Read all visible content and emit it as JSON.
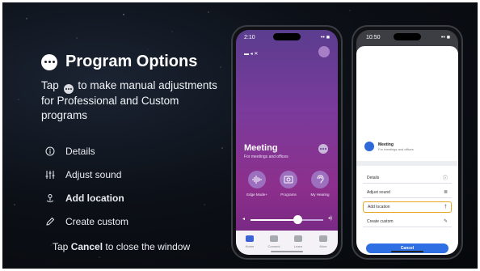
{
  "slide": {
    "title": "Program Options",
    "intro_before": "Tap",
    "intro_after": "to make manual adjustments for Professional and Custom programs",
    "options": [
      {
        "label": "Details",
        "icon": "info-icon",
        "bold": false
      },
      {
        "label": "Adjust sound",
        "icon": "sliders-icon",
        "bold": false
      },
      {
        "label": "Add location",
        "icon": "location-pin-icon",
        "bold": true
      },
      {
        "label": "Create custom",
        "icon": "pencil-icon",
        "bold": false
      }
    ],
    "footer_before": "Tap",
    "footer_bold": "Cancel",
    "footer_after": "to close the window"
  },
  "phone_left": {
    "time": "2:10",
    "status_right": "•• ■",
    "program_name": "Meeting",
    "program_desc": "For meetings and offices",
    "buttons": [
      {
        "label": "Edge Mode+",
        "icon": "waveform-icon"
      },
      {
        "label": "Programs",
        "icon": "programs-icon"
      },
      {
        "label": "My Hearing",
        "icon": "ear-icon"
      }
    ],
    "volume_level": 0.62,
    "nav": [
      "Home",
      "Connect",
      "Learn",
      "More"
    ]
  },
  "phone_right": {
    "time": "10:50",
    "status_right": "•• ■",
    "program_name": "Meeting",
    "program_desc": "For meetings and offices",
    "menu": [
      {
        "label": "Details",
        "icon": "ⓘ",
        "selected": false
      },
      {
        "label": "Adjust sound",
        "icon": "≣",
        "selected": false
      },
      {
        "label": "Add location",
        "icon": "†",
        "selected": true
      },
      {
        "label": "Create custom",
        "icon": "✎",
        "selected": false
      }
    ],
    "cancel_label": "Cancel"
  },
  "colors": {
    "accent_blue": "#2e6fe3",
    "selection_orange": "#e6a51c",
    "phone_purple": "#7a3b9c"
  }
}
